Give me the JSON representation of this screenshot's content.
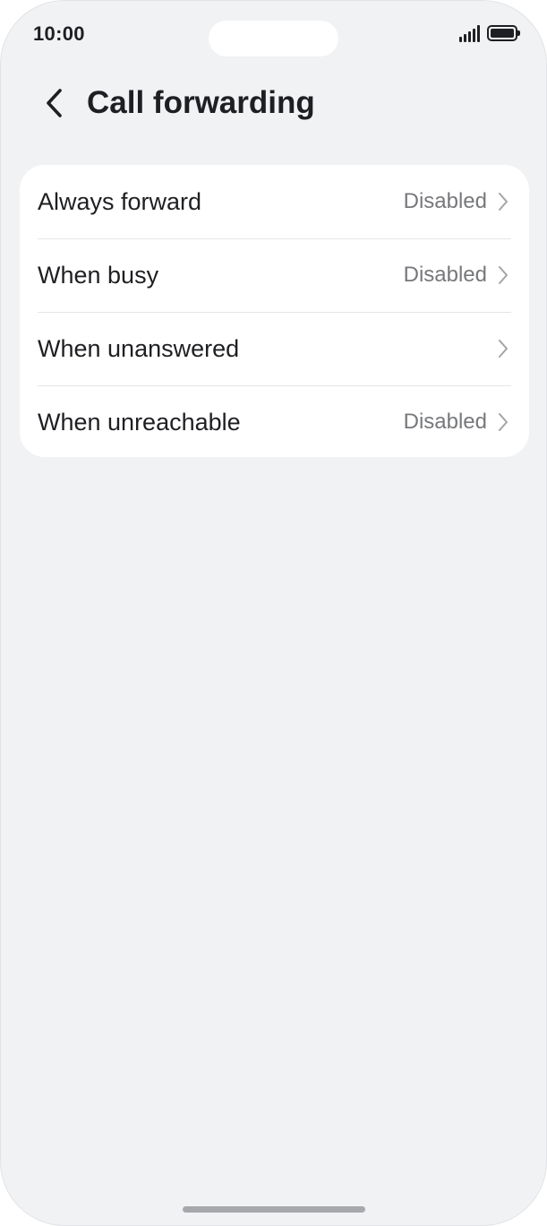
{
  "status_bar": {
    "time": "10:00",
    "signal_icon": "cellular-signal-icon",
    "battery_icon": "battery-full-icon"
  },
  "header": {
    "back_icon": "chevron-left-icon",
    "title": "Call forwarding"
  },
  "settings": [
    {
      "label": "Always forward",
      "value": "Disabled",
      "icon": "chevron-right-icon"
    },
    {
      "label": "When busy",
      "value": "Disabled",
      "icon": "chevron-right-icon"
    },
    {
      "label": "When unanswered",
      "value": "",
      "icon": "chevron-right-icon"
    },
    {
      "label": "When unreachable",
      "value": "Disabled",
      "icon": "chevron-right-icon"
    }
  ],
  "colors": {
    "background": "#f1f2f4",
    "card": "#ffffff",
    "text_primary": "#1e1f22",
    "text_secondary": "#77787c",
    "divider": "#e4e5e8"
  }
}
